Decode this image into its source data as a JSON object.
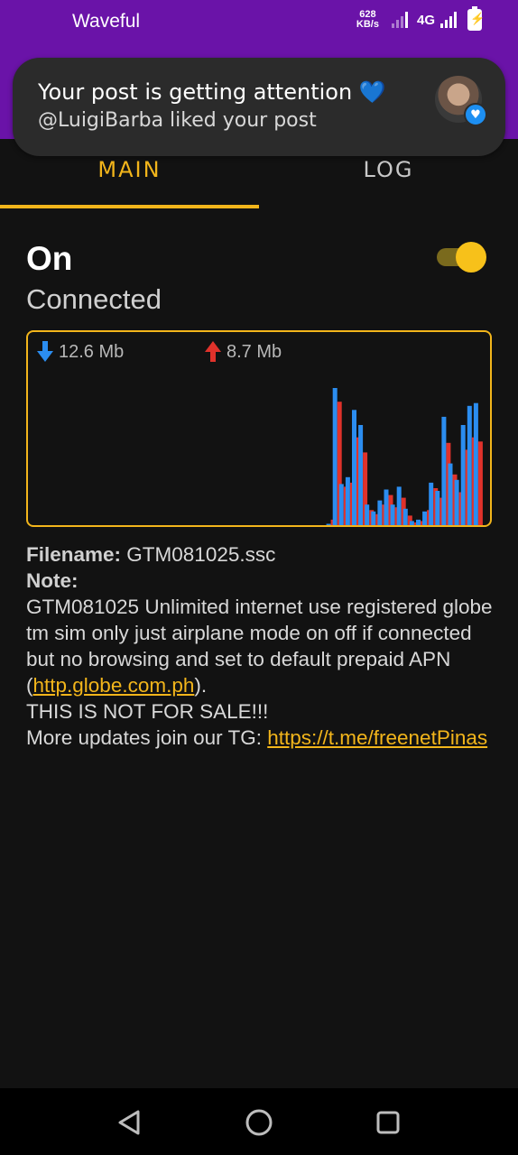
{
  "status_bar": {
    "app_name": "Waveful",
    "net_speed_value": "628",
    "net_speed_unit": "KB/s",
    "network_type": "4G"
  },
  "notification": {
    "title": "Your post is getting attention 💙",
    "body": "@LuigiBarba liked your post"
  },
  "tabs": [
    {
      "label": "MAIN",
      "active": true
    },
    {
      "label": "LOG",
      "active": false
    }
  ],
  "connection": {
    "state": "On",
    "status": "Connected",
    "toggle_on": true
  },
  "traffic": {
    "download": "12.6 Mb",
    "upload": "8.7 Mb",
    "download_color": "#2b8df0",
    "upload_color": "#e0322b",
    "max": 100,
    "bars": [
      {
        "down": 0,
        "up": 0
      },
      {
        "down": 0,
        "up": 0
      },
      {
        "down": 0,
        "up": 0
      },
      {
        "down": 0,
        "up": 0
      },
      {
        "down": 0,
        "up": 0
      },
      {
        "down": 0,
        "up": 0
      },
      {
        "down": 0,
        "up": 0
      },
      {
        "down": 0,
        "up": 0
      },
      {
        "down": 0,
        "up": 0
      },
      {
        "down": 0,
        "up": 0
      },
      {
        "down": 0,
        "up": 0
      },
      {
        "down": 0,
        "up": 0
      },
      {
        "down": 0,
        "up": 0
      },
      {
        "down": 0,
        "up": 0
      },
      {
        "down": 0,
        "up": 0
      },
      {
        "down": 0,
        "up": 0
      },
      {
        "down": 0,
        "up": 0
      },
      {
        "down": 0,
        "up": 0
      },
      {
        "down": 0,
        "up": 0
      },
      {
        "down": 0,
        "up": 0
      },
      {
        "down": 0,
        "up": 0
      },
      {
        "down": 0,
        "up": 0
      },
      {
        "down": 0,
        "up": 0
      },
      {
        "down": 1,
        "up": 4
      },
      {
        "down": 100,
        "up": 90
      },
      {
        "down": 30,
        "up": 28
      },
      {
        "down": 35,
        "up": 31
      },
      {
        "down": 84,
        "up": 64
      },
      {
        "down": 73,
        "up": 53
      },
      {
        "down": 15,
        "up": 11
      },
      {
        "down": 10,
        "up": 8
      },
      {
        "down": 18,
        "up": 15
      },
      {
        "down": 26,
        "up": 22
      },
      {
        "down": 15,
        "up": 13
      },
      {
        "down": 28,
        "up": 20
      },
      {
        "down": 12,
        "up": 7
      },
      {
        "down": 3,
        "up": 2
      },
      {
        "down": 4,
        "up": 3
      },
      {
        "down": 10,
        "up": 11
      },
      {
        "down": 31,
        "up": 27
      },
      {
        "down": 25,
        "up": 20
      },
      {
        "down": 79,
        "up": 60
      },
      {
        "down": 45,
        "up": 37
      },
      {
        "down": 33,
        "up": 24
      },
      {
        "down": 73,
        "up": 55
      },
      {
        "down": 87,
        "up": 64
      },
      {
        "down": 89,
        "up": 61
      }
    ]
  },
  "info": {
    "filename_label": "Filename:",
    "filename": "GTM081025.ssc",
    "note_label": "Note:",
    "note_line1": "GTM081025 Unlimited internet use registered globe tm sim only just airplane mode on off if connected but no browsing and set to default prepaid APN (",
    "apn_link": "http.globe.com.ph",
    "note_line1_end": ").",
    "note_line2": "THIS IS NOT FOR SALE!!!",
    "note_line3": "More updates join our TG: ",
    "tg_link": "https://t.me/freenetPinas"
  },
  "nav": {
    "back_icon": "back-triangle-icon",
    "home_icon": "home-circle-icon",
    "recents_icon": "recents-square-icon"
  }
}
